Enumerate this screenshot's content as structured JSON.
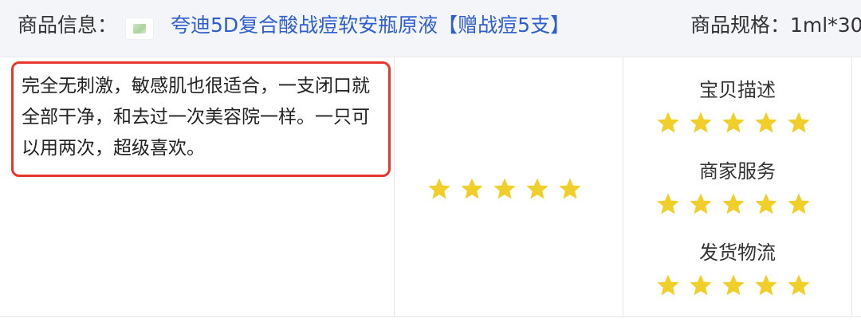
{
  "info_bar": {
    "label": "商品信息：",
    "product_name": "夸迪5D复合酸战痘软安瓶原液【赠战痘5支】",
    "spec": "商品规格：1ml*30"
  },
  "review": {
    "text": "完全无刺激，敏感肌也很适合，一支闭口就全部干净，和去过一次美容院一样。一只可以用两次，超级喜欢。"
  },
  "overall_rating": {
    "stars": 5,
    "max": 5
  },
  "ratings": [
    {
      "label": "宝贝描述",
      "stars": 5,
      "max": 5
    },
    {
      "label": "商家服务",
      "stars": 5,
      "max": 5
    },
    {
      "label": "发货物流",
      "stars": 5,
      "max": 5
    }
  ],
  "colors": {
    "star": "#f1cf2a",
    "highlight_border": "#e8372d",
    "link": "#2f5fcf",
    "header_bg": "#f3f5f9"
  },
  "icons": {
    "thumbnail": "product-thumbnail-icon",
    "star": "star-icon"
  }
}
